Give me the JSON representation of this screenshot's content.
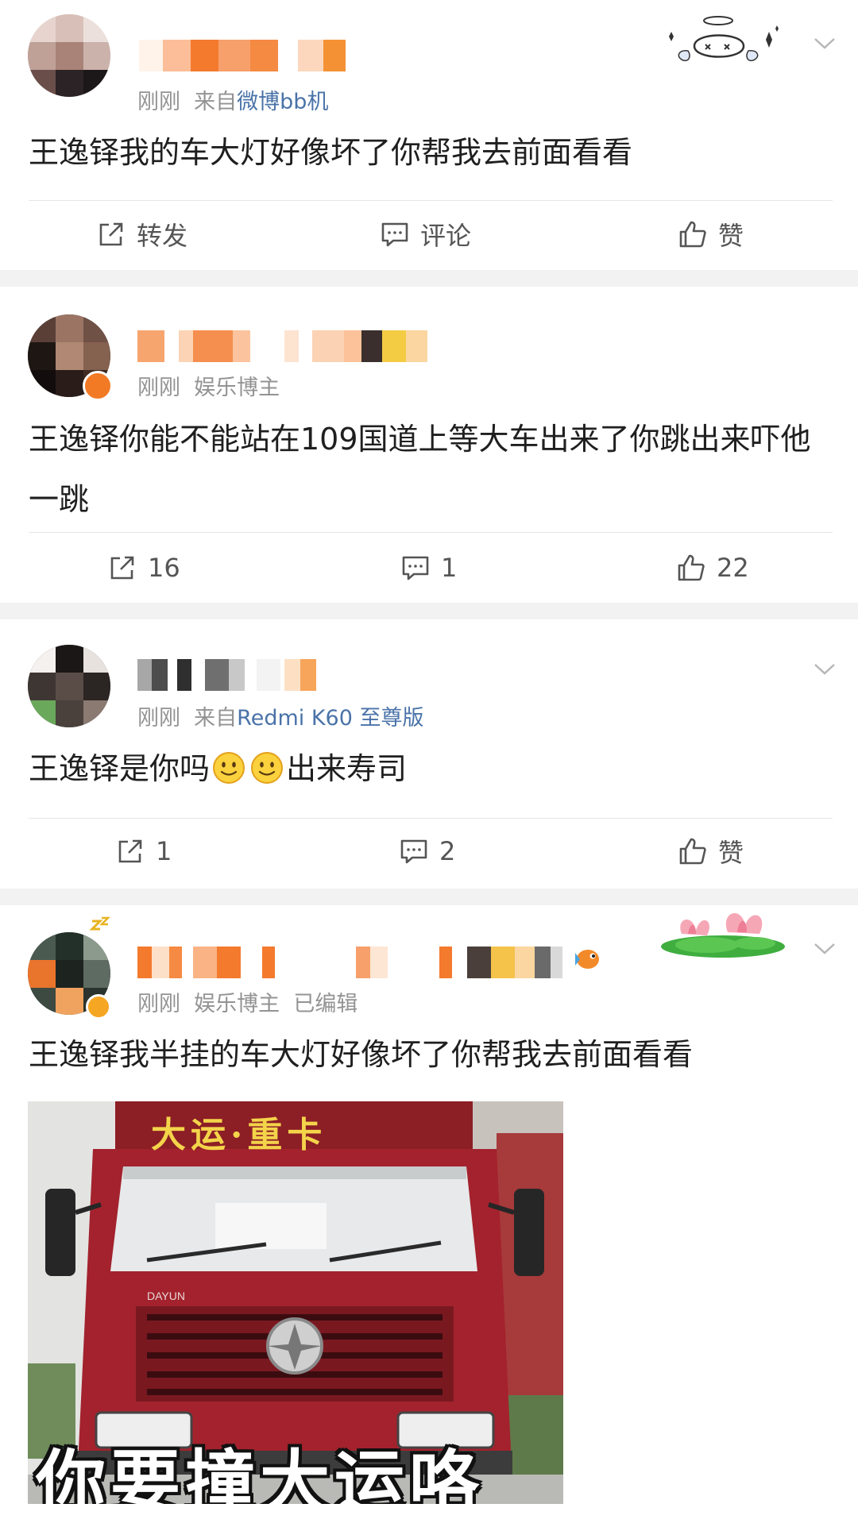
{
  "posts": [
    {
      "time": "刚刚",
      "source_prefix": "来自",
      "source": "微博bb机",
      "content": "王逸铎我的车大灯好像坏了你帮我去前面看看",
      "actions": {
        "repost": "转发",
        "comment": "评论",
        "like": "赞"
      }
    },
    {
      "time": "刚刚",
      "tag": "娱乐博主",
      "content": "王逸铎你能不能站在109国道上等大车出来了你跳出来吓他一跳",
      "actions": {
        "repost": "16",
        "comment": "1",
        "like": "22"
      }
    },
    {
      "time": "刚刚",
      "source_prefix": "来自",
      "source": "Redmi K60 至尊版",
      "content_before": "王逸铎是你吗",
      "content_after": "出来寿司",
      "actions": {
        "repost": "1",
        "comment": "2",
        "like": "赞"
      }
    },
    {
      "time": "刚刚",
      "tag": "娱乐博主",
      "edited": "已编辑",
      "content": "王逸铎我半挂的车大灯好像坏了你帮我去前面看看",
      "image": {
        "top_caption": "大运·重卡",
        "bottom_caption": "你要撞大运咯",
        "grille_badge": "DAYUN"
      }
    }
  ],
  "icons": {
    "repost": "share-out-icon",
    "comment": "comment-bubble-icon",
    "like": "thumbs-up-icon",
    "menu": "chevron-down-icon"
  },
  "colors": {
    "link": "#4a73a8",
    "meta": "#939393",
    "text": "#1f1f1f",
    "separator": "#f2f2f2"
  }
}
